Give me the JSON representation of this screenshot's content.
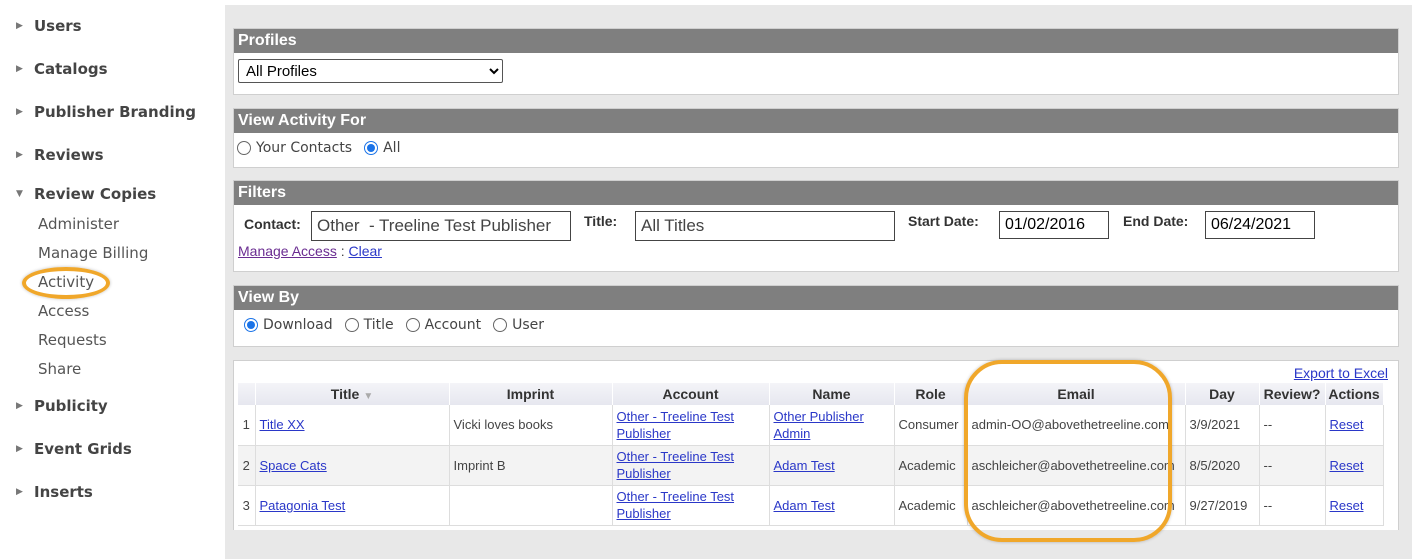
{
  "sidebar": {
    "items": [
      {
        "label": "Users",
        "expanded": false
      },
      {
        "label": "Catalogs",
        "expanded": false
      },
      {
        "label": "Publisher Branding",
        "expanded": false
      },
      {
        "label": "Reviews",
        "expanded": false
      },
      {
        "label": "Review Copies",
        "expanded": true
      },
      {
        "label": "Publicity",
        "expanded": false
      },
      {
        "label": "Event Grids",
        "expanded": false
      },
      {
        "label": "Inserts",
        "expanded": false
      }
    ],
    "review_copies_children": [
      "Administer",
      "Manage Billing",
      "Activity",
      "Access",
      "Requests",
      "Share"
    ]
  },
  "profiles": {
    "heading": "Profiles",
    "selected": "All Profiles"
  },
  "view_activity_for": {
    "heading": "View Activity For",
    "options": [
      "Your Contacts",
      "All"
    ],
    "selected": "All"
  },
  "filters": {
    "heading": "Filters",
    "contact_label": "Contact:",
    "contact_value": "Other  - Treeline Test Publisher",
    "title_label": "Title:",
    "title_value": "All Titles",
    "start_label": "Start Date:",
    "start_value": "01/02/2016",
    "end_label": "End Date:",
    "end_value": "06/24/2021",
    "manage_access": "Manage Access",
    "separator": " : ",
    "clear": "Clear"
  },
  "view_by": {
    "heading": "View By",
    "options": [
      "Download",
      "Title",
      "Account",
      "User"
    ],
    "selected": "Download"
  },
  "results": {
    "export_label": "Export to Excel",
    "columns": [
      "",
      "Title",
      "Imprint",
      "Account",
      "Name",
      "Role",
      "Email",
      "Day",
      "Review?",
      "Actions"
    ],
    "rows": [
      {
        "n": "1",
        "title": "Title XX",
        "imprint": "Vicki loves books",
        "account": "Other - Treeline Test Publisher",
        "name": "Other Publisher Admin",
        "role": "Consumer",
        "email": "admin-OO@abovethetreeline.com",
        "day": "3/9/2021",
        "review": "--",
        "action": "Reset"
      },
      {
        "n": "2",
        "title": "Space Cats",
        "imprint": "Imprint B",
        "account": "Other - Treeline Test Publisher",
        "name": "Adam Test",
        "role": "Academic",
        "email": "aschleicher@abovethetreeline.com",
        "day": "8/5/2020",
        "review": "--",
        "action": "Reset"
      },
      {
        "n": "3",
        "title": "Patagonia Test",
        "imprint": "",
        "account": "Other - Treeline Test Publisher",
        "name": "Adam Test",
        "role": "Academic",
        "email": "aschleicher@abovethetreeline.com",
        "day": "9/27/2019",
        "review": "--",
        "action": "Reset"
      }
    ]
  },
  "colors": {
    "panel_header": "#7f7f7f",
    "highlight": "#f0a72a",
    "link": "#2a37c8",
    "radio_checked": "#1a73e8"
  }
}
